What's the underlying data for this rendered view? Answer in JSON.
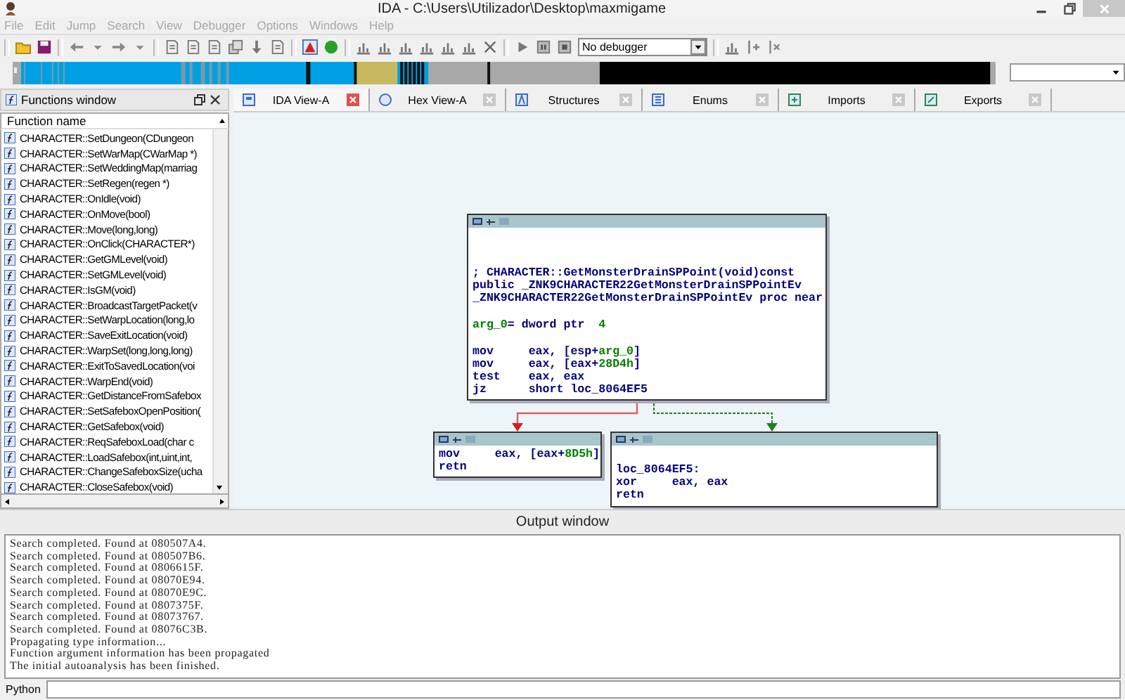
{
  "window": {
    "title": "IDA - C:\\Users\\Utilizador\\Desktop\\maxmigame"
  },
  "menu": [
    "File",
    "Edit",
    "Jump",
    "Search",
    "View",
    "Debugger",
    "Options",
    "Windows",
    "Help"
  ],
  "toolbar": {
    "debugger_select": "No debugger"
  },
  "functions_window": {
    "title": "Functions window",
    "column": "Function name",
    "items": [
      "CHARACTER::SetDungeon(CDungeon",
      "CHARACTER::SetWarMap(CWarMap *)",
      "CHARACTER::SetWeddingMap(marriag",
      "CHARACTER::SetRegen(regen *)",
      "CHARACTER::OnIdle(void)",
      "CHARACTER::OnMove(bool)",
      "CHARACTER::Move(long,long)",
      "CHARACTER::OnClick(CHARACTER*)",
      "CHARACTER::GetGMLevel(void)",
      "CHARACTER::SetGMLevel(void)",
      "CHARACTER::IsGM(void)",
      "CHARACTER::BroadcastTargetPacket(v",
      "CHARACTER::SetWarpLocation(long,lo",
      "CHARACTER::SaveExitLocation(void)",
      "CHARACTER::WarpSet(long,long,long)",
      "CHARACTER::ExitToSavedLocation(voi",
      "CHARACTER::WarpEnd(void)",
      "CHARACTER::GetDistanceFromSafebox",
      "CHARACTER::SetSafeboxOpenPosition(",
      "CHARACTER::GetSafebox(void)",
      "CHARACTER::ReqSafeboxLoad(char c",
      "CHARACTER::LoadSafebox(int,uint,int,",
      "CHARACTER::ChangeSafeboxSize(ucha",
      "CHARACTER::CloseSafebox(void)"
    ]
  },
  "tabs": [
    {
      "label": "IDA View-A",
      "selected": true
    },
    {
      "label": "Hex View-A",
      "selected": false
    },
    {
      "label": "Structures",
      "selected": false
    },
    {
      "label": "Enums",
      "selected": false
    },
    {
      "label": "Imports",
      "selected": false
    },
    {
      "label": "Exports",
      "selected": false
    }
  ],
  "graph": {
    "nodes": [
      {
        "blocks": [
          [
            [
              {
                "text": "; CHARACTER::GetMonsterDrainSPPoint(void)const",
                "kind": "code"
              }
            ],
            [
              {
                "text": "public _ZNK9CHARACTER22GetMonsterDrainSPPointEv",
                "kind": "code"
              }
            ],
            [
              {
                "text": "_ZNK9CHARACTER22GetMonsterDrainSPPointEv proc near",
                "kind": "code"
              }
            ]
          ],
          [
            [
              {
                "text": "arg_0",
                "kind": "name"
              },
              {
                "text": "= dword ptr  ",
                "kind": "code"
              },
              {
                "text": "4",
                "kind": "name"
              }
            ]
          ],
          [
            [
              {
                "text": "mov     eax, [esp+",
                "kind": "code"
              },
              {
                "text": "arg_0",
                "kind": "name"
              },
              {
                "text": "]",
                "kind": "code"
              }
            ],
            [
              {
                "text": "mov     eax, [eax+",
                "kind": "code"
              },
              {
                "text": "28D4h",
                "kind": "name"
              },
              {
                "text": "]",
                "kind": "code"
              }
            ],
            [
              {
                "text": "test    eax, eax",
                "kind": "code"
              }
            ],
            [
              {
                "text": "jz      short loc_8064EF5",
                "kind": "code"
              }
            ]
          ]
        ]
      },
      {
        "blocks": [
          [
            [
              {
                "text": "mov     eax, [eax+",
                "kind": "code"
              },
              {
                "text": "8D5h",
                "kind": "name"
              },
              {
                "text": "]",
                "kind": "code"
              }
            ],
            [
              {
                "text": "retn",
                "kind": "code"
              }
            ]
          ]
        ]
      },
      {
        "blocks": [
          [
            [
              {
                "text": "loc_8064EF5:",
                "kind": "code"
              }
            ],
            [
              {
                "text": "xor     eax, eax",
                "kind": "code"
              }
            ],
            [
              {
                "text": "retn",
                "kind": "code"
              }
            ]
          ]
        ]
      }
    ]
  },
  "output_window": {
    "title": "Output window",
    "lines": [
      "Search completed. Found at 080507A4.",
      "Search completed. Found at 080507B6.",
      "Search completed. Found at 0806615F.",
      "Search completed. Found at 08070E94.",
      "Search completed. Found at 08070E9C.",
      "Search completed. Found at 0807375F.",
      "Search completed. Found at 08073767.",
      "Search completed. Found at 08076C3B.",
      "Propagating type information...",
      "Function argument information has been propagated",
      "The initial autoanalysis has been finished."
    ]
  },
  "command_bar": {
    "label": "Python"
  }
}
